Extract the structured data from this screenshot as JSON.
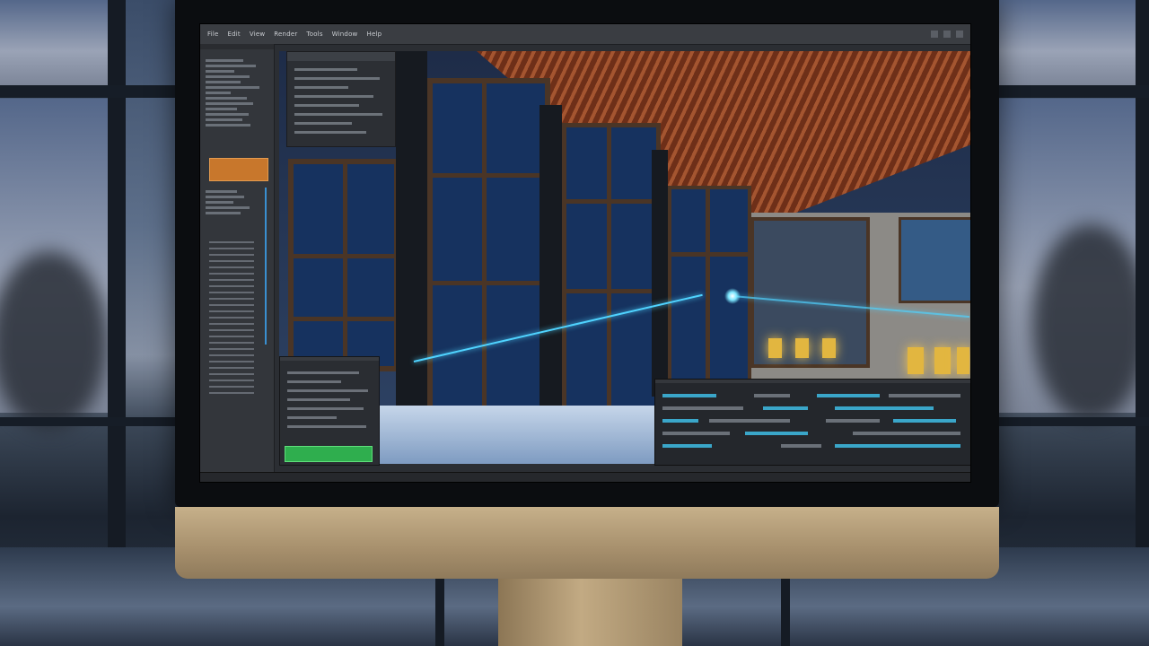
{
  "menubar": {
    "items": [
      "File",
      "Edit",
      "View",
      "Render",
      "Tools",
      "Window",
      "Help"
    ]
  },
  "panels": {
    "left_header": "",
    "console_header": "",
    "layers_header": "",
    "render_button": ""
  },
  "colors": {
    "accent_orange": "#c8772c",
    "accent_green": "#2fae4e",
    "laser_cyan": "#4fd3ff"
  },
  "icons": [
    "window-minimize-icon",
    "window-maximize-icon",
    "window-close-icon"
  ]
}
